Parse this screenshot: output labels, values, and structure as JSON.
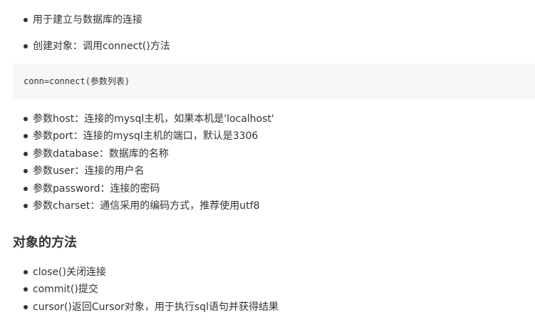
{
  "intro_items": [
    "用于建立与数据库的连接",
    "创建对象：调用connect()方法"
  ],
  "code": "conn=connect(参数列表)",
  "params": [
    "参数host：连接的mysql主机，如果本机是'localhost'",
    "参数port：连接的mysql主机的端口，默认是3306",
    "参数database：数据库的名称",
    "参数user：连接的用户名",
    "参数password：连接的密码",
    "参数charset：通信采用的编码方式，推荐使用utf8"
  ],
  "methods_heading": "对象的方法",
  "methods": [
    "close()关闭连接",
    "commit()提交",
    "cursor()返回Cursor对象，用于执行sql语句并获得结果"
  ],
  "colors": {
    "text": "#333333",
    "code_background": "#f7f7f7",
    "page_background": "#ffffff"
  }
}
